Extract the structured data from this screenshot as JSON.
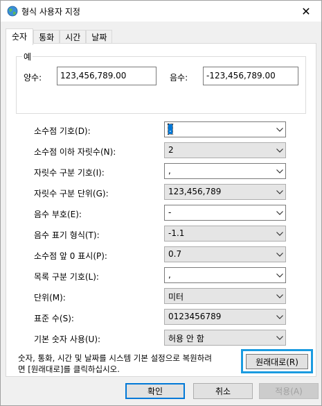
{
  "window": {
    "title": "형식 사용자 지정",
    "close_glyph": "✕"
  },
  "tabs": [
    {
      "label": "숫자",
      "active": true
    },
    {
      "label": "통화",
      "active": false
    },
    {
      "label": "시간",
      "active": false
    },
    {
      "label": "날짜",
      "active": false
    }
  ],
  "example": {
    "legend": "예",
    "positive_label": "양수:",
    "positive_value": "123,456,789.00",
    "negative_label": "음수:",
    "negative_value": "-123,456,789.00"
  },
  "settings": [
    {
      "label": "소수점 기호(D):",
      "value": ".",
      "editable": true,
      "focused": true
    },
    {
      "label": "소수점 이하 자릿수(N):",
      "value": "2",
      "editable": false
    },
    {
      "label": "자릿수 구분 기호(I):",
      "value": ",",
      "editable": true
    },
    {
      "label": "자릿수 구분 단위(G):",
      "value": "123,456,789",
      "editable": false
    },
    {
      "label": "음수 부호(E):",
      "value": "-",
      "editable": true
    },
    {
      "label": "음수 표기 형식(T):",
      "value": "-1.1",
      "editable": false
    },
    {
      "label": "소수점 앞 0 표시(P):",
      "value": "0.7",
      "editable": false
    },
    {
      "label": "목록 구분 기호(L):",
      "value": ",",
      "editable": true
    },
    {
      "label": "단위(M):",
      "value": "미터",
      "editable": false
    },
    {
      "label": "표준 수(S):",
      "value": "0123456789",
      "editable": false
    },
    {
      "label": "기본 숫자 사용(U):",
      "value": "허용 안 함",
      "editable": false
    }
  ],
  "note": {
    "line1": "숫자, 통화, 시간 및 날짜를 시스템 기본 설정으로 복원하려",
    "line2": "면 [원래대로]를 클릭하십시오."
  },
  "buttons": {
    "reset": "원래대로(R)",
    "ok": "확인",
    "cancel": "취소",
    "apply": "적용(A)"
  },
  "colors": {
    "highlight": "#1a9be0",
    "focus": "#0078d7"
  }
}
